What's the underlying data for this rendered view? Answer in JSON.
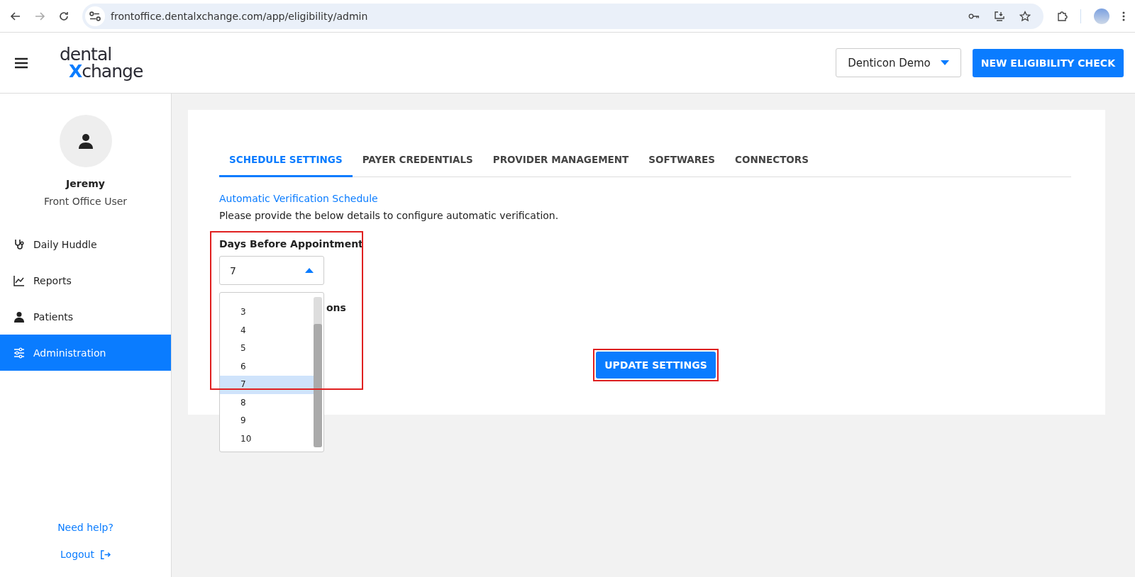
{
  "browser": {
    "url": "frontoffice.dentalxchange.com/app/eligibility/admin"
  },
  "header": {
    "logo_top": "dental",
    "logo_x": "X",
    "logo_rest": "change",
    "practice": "Denticon Demo",
    "action": "NEW ELIGIBILITY CHECK"
  },
  "user": {
    "name": "Jeremy",
    "role": "Front Office User"
  },
  "nav": [
    {
      "label": "Daily Huddle",
      "kind": "stethoscope",
      "selected": false
    },
    {
      "label": "Reports",
      "kind": "chart",
      "selected": false
    },
    {
      "label": "Patients",
      "kind": "person",
      "selected": false
    },
    {
      "label": "Administration",
      "kind": "sliders",
      "selected": true
    }
  ],
  "sidebar_footer": {
    "help": "Need help?",
    "logout": "Logout"
  },
  "tabs": [
    {
      "label": "SCHEDULE SETTINGS",
      "selected": true
    },
    {
      "label": "PAYER CREDENTIALS",
      "selected": false
    },
    {
      "label": "PROVIDER MANAGEMENT",
      "selected": false
    },
    {
      "label": "SOFTWARES",
      "selected": false
    },
    {
      "label": "CONNECTORS",
      "selected": false
    }
  ],
  "section": {
    "title": "Automatic Verification Schedule",
    "description": "Please provide the below details to configure automatic verification."
  },
  "days_field": {
    "label": "Days Before Appointment",
    "value": "7",
    "expanded": true,
    "options": [
      {
        "label": "3",
        "selected": false
      },
      {
        "label": "4",
        "selected": false
      },
      {
        "label": "5",
        "selected": false
      },
      {
        "label": "6",
        "selected": false
      },
      {
        "label": "7",
        "selected": true
      },
      {
        "label": "8",
        "selected": false
      },
      {
        "label": "9",
        "selected": false
      },
      {
        "label": "10",
        "selected": false
      }
    ]
  },
  "hidden_label_fragment": "ons",
  "submit": "UPDATE SETTINGS"
}
